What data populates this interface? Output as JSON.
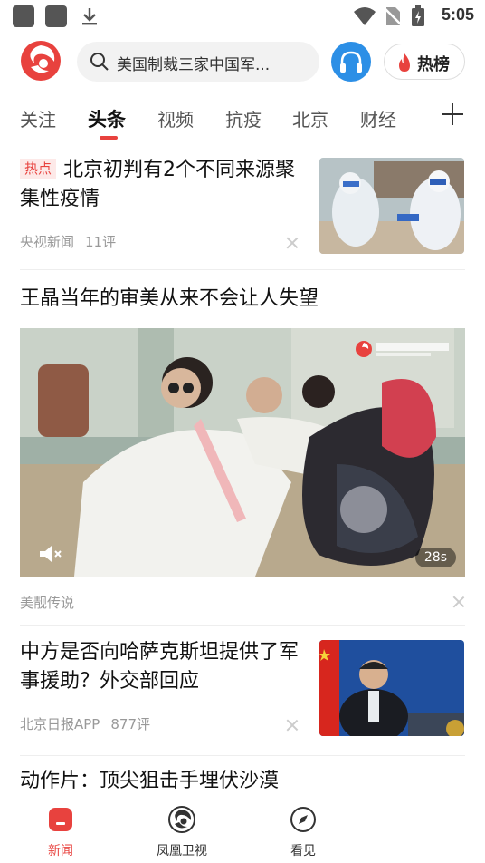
{
  "status_bar": {
    "time": "5:05"
  },
  "header": {
    "search_placeholder": "美国制裁三家中国军...",
    "hot_label": "热榜"
  },
  "tabs": [
    {
      "label": "关注"
    },
    {
      "label": "头条"
    },
    {
      "label": "视频"
    },
    {
      "label": "抗疫"
    },
    {
      "label": "北京"
    },
    {
      "label": "财经"
    }
  ],
  "feed": [
    {
      "badge": "热点",
      "title": "北京初判有2个不同来源聚集性疫情",
      "source": "央视新闻",
      "comments": "11评"
    },
    {
      "title": "王晶当年的审美从来不会让人失望",
      "source": "美靓传说",
      "duration": "28s"
    },
    {
      "title": "中方是否向哈萨克斯坦提供了军事援助？外交部回应",
      "source": "北京日报APP",
      "comments": "877评"
    },
    {
      "title": "动作片：顶尖狙击手埋伏沙漠"
    }
  ],
  "bottom_nav": [
    {
      "label": "新闻"
    },
    {
      "label": "凤凰卫视"
    },
    {
      "label": "看见"
    }
  ],
  "colors": {
    "accent": "#e8423e",
    "audio": "#2c8fe6"
  }
}
